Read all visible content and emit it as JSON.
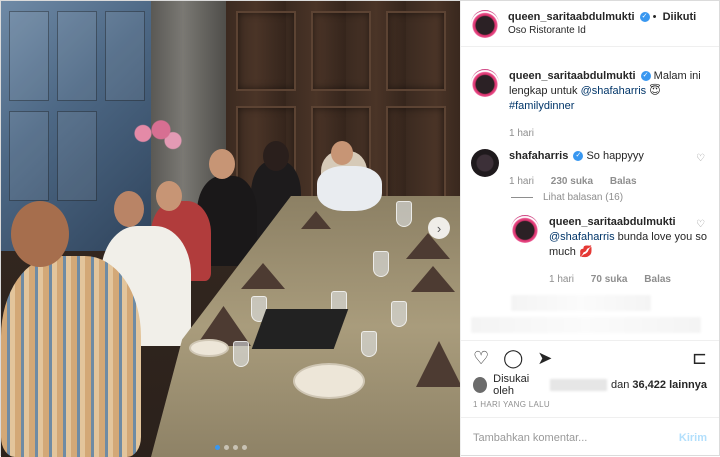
{
  "header": {
    "username": "queen_saritaabdulmukti",
    "verified_mark": "✓",
    "separator": "•",
    "follow_label": "Diikuti",
    "location": "Oso Ristorante Id"
  },
  "caption": {
    "username": "queen_saritaabdulmukti",
    "text": "Malam ini lengkap untuk",
    "mention": "@shafaharris",
    "emoji": "😇",
    "hashtag": "#familydinner",
    "time": "1 hari"
  },
  "comments": [
    {
      "username": "shafaharris",
      "text": "So happyyy",
      "time": "1 hari",
      "likes": "230 suka",
      "reply_label": "Balas",
      "view_replies": "Lihat balasan (16)"
    }
  ],
  "reply": {
    "username": "queen_saritaabdulmukti",
    "mention": "@shafaharris",
    "text": "bunda love you so much",
    "emoji": "💋",
    "time": "1 hari",
    "likes": "70 suka",
    "reply_label": "Balas"
  },
  "icons": {
    "heart": "♡",
    "comment": "◯",
    "share": "➤",
    "save": "⊏",
    "next": "›"
  },
  "likes_line": {
    "prefix": "Disukai oleh",
    "middle": "dan",
    "count": "36,422",
    "suffix": "lainnya"
  },
  "post_date": "1 HARI YANG LALU",
  "add_comment": {
    "placeholder": "Tambahkan komentar...",
    "post_label": "Kirim"
  },
  "carousel": {
    "total": 4,
    "current": 1
  },
  "colors": {
    "accent": "#3897f0",
    "link": "#003569",
    "muted": "#8e8e8e",
    "post_disabled": "#b2dffc"
  }
}
